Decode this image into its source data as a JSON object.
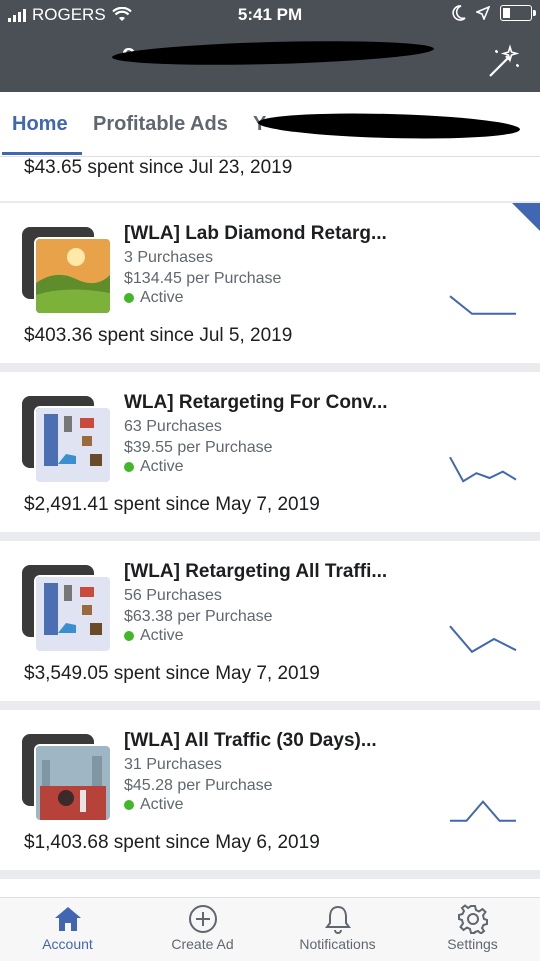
{
  "status_bar": {
    "carrier": "ROGERS",
    "time": "5:41 PM"
  },
  "header": {
    "account_initial": "o",
    "magic_icon": "magic-wand-icon"
  },
  "tabs": [
    {
      "label": "Home",
      "active": true
    },
    {
      "label": "Profitable Ads",
      "active": false
    },
    {
      "label": "Y",
      "active": false
    }
  ],
  "partial_card": {
    "spent": "$43.65 spent since Jul 23, 2019"
  },
  "campaigns": [
    {
      "title": "[WLA] Lab Diamond Retarg...",
      "purchases": "3 Purchases",
      "cost": "$134.45 per Purchase",
      "status": "Active",
      "spent": "$403.36 spent since Jul 5, 2019",
      "trend": [
        0.35,
        0.9,
        0.9,
        0.9
      ]
    },
    {
      "title": "WLA] Retargeting For Conv...",
      "purchases": "63 Purchases",
      "cost": "$39.55 per Purchase",
      "status": "Active",
      "spent": "$2,491.41 spent since May 7, 2019",
      "trend": [
        0.1,
        0.85,
        0.6,
        0.75,
        0.55,
        0.8
      ]
    },
    {
      "title": "[WLA] Retargeting All Traffi...",
      "purchases": "56 Purchases",
      "cost": "$63.38 per Purchase",
      "status": "Active",
      "spent": "$3,549.05 spent since May 7, 2019",
      "trend": [
        0.1,
        0.9,
        0.5,
        0.85
      ]
    },
    {
      "title": "[WLA] All Traffic (30 Days)...",
      "purchases": "31 Purchases",
      "cost": "$45.28 per Purchase",
      "status": "Active",
      "spent": "$1,403.68 spent since May 6, 2019",
      "trend": [
        0.9,
        0.9,
        0.3,
        0.9,
        0.9
      ]
    }
  ],
  "bottom_nav": [
    {
      "label": "Account",
      "active": true
    },
    {
      "label": "Create Ad",
      "active": false
    },
    {
      "label": "Notifications",
      "active": false
    },
    {
      "label": "Settings",
      "active": false
    }
  ],
  "colors": {
    "accent": "#4267b2",
    "active_dot": "#42b72a",
    "header_bg": "#4b4f56"
  }
}
